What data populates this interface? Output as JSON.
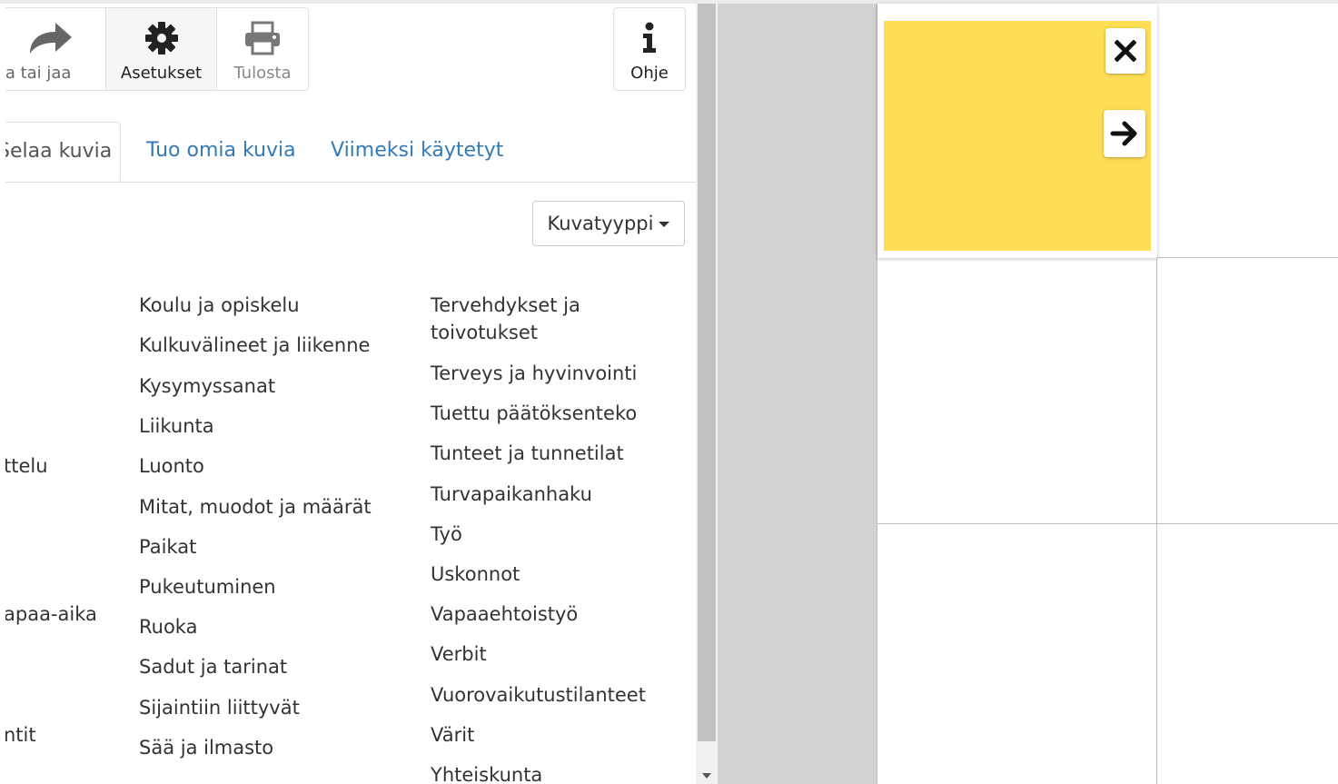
{
  "toolbar": {
    "share_label": "nna tai jaa",
    "settings_label": "Asetukset",
    "print_label": "Tulosta",
    "help_label": "Ohje"
  },
  "tabs": [
    {
      "label": "Selaa kuvia",
      "active": true
    },
    {
      "label": "Tuo omia kuvia",
      "active": false
    },
    {
      "label": "Viimeksi käytetyt",
      "active": false
    }
  ],
  "filter": {
    "label": "Kuvatyyppi"
  },
  "categories": {
    "col0": [
      "ttelu",
      "apaa-aika",
      "ntit"
    ],
    "col1": [
      "Koulu ja opiskelu",
      "Kulkuvälineet ja liikenne",
      "Kysymyssanat",
      "Liikunta",
      "Luonto",
      "Mitat, muodot ja määrät",
      "Paikat",
      "Pukeutuminen",
      "Ruoka",
      "Sadut ja tarinat",
      "Sijaintiin liittyvät",
      "Sää ja ilmasto"
    ],
    "col2": [
      "Tervehdykset ja toivotukset",
      "Terveys ja hyvinvointi",
      "Tuettu päätöksenteko",
      "Tunteet ja tunnetilat",
      "Turvapaikanhaku",
      "Työ",
      "Uskonnot",
      "Vapaaehtoistyö",
      "Verbit",
      "Vuorovaikutustilanteet",
      "Värit",
      "Yhteiskunta"
    ]
  },
  "colors": {
    "link": "#337ab7",
    "card_fill": "#ffdd55",
    "icon_dark": "#222222",
    "icon_muted": "#666666"
  },
  "icons": {
    "share": "share-arrow-icon",
    "settings": "gear-icon",
    "print": "printer-icon",
    "help": "info-icon",
    "close": "close-icon",
    "next": "arrow-right-icon"
  }
}
